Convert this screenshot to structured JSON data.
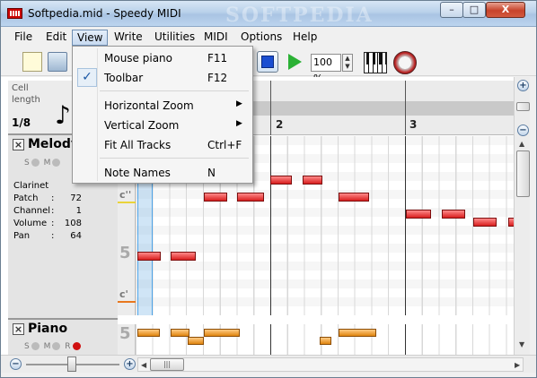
{
  "window": {
    "title": "Softpedia.mid - Speedy MIDI",
    "watermark": "SOFTPEDIA",
    "minimize": "–",
    "maximize": "□",
    "close": "X"
  },
  "menubar": {
    "items": [
      "File",
      "Edit",
      "View",
      "Write",
      "Utilities",
      "MIDI",
      "Options",
      "Help"
    ],
    "active": "View"
  },
  "toolbar": {
    "zoom_value": "100 %",
    "icons": [
      "new-document-icon",
      "open-folder-icon",
      "stop-icon",
      "play-icon",
      "piano-icon",
      "drum-icon"
    ]
  },
  "view_menu": {
    "items": [
      {
        "label": "Mouse piano",
        "shortcut": "F11",
        "checked": false,
        "submenu": false
      },
      {
        "label": "Toolbar",
        "shortcut": "F12",
        "checked": true,
        "submenu": false
      },
      {
        "label": "Horizontal Zoom",
        "shortcut": "",
        "checked": false,
        "submenu": true
      },
      {
        "label": "Vertical Zoom",
        "shortcut": "",
        "checked": false,
        "submenu": true
      },
      {
        "label": "Fit All Tracks",
        "shortcut": "Ctrl+F",
        "checked": false,
        "submenu": false
      },
      {
        "label": "Note Names",
        "shortcut": "N",
        "checked": false,
        "submenu": false
      }
    ]
  },
  "cell": {
    "label": "Cell length",
    "value": "1/8",
    "icon": "eighth-note-icon"
  },
  "ruler": {
    "measures": [
      "2",
      "3"
    ]
  },
  "tracks": [
    {
      "name": "Melody",
      "solo": "S",
      "mute": "M",
      "instrument": "Clarinet",
      "props": [
        {
          "key": "Patch",
          "value": "72"
        },
        {
          "key": "Channel",
          "value": "1"
        },
        {
          "key": "Volume",
          "value": "108"
        },
        {
          "key": "Pan",
          "value": "64"
        }
      ],
      "lane_labels": [
        "c''",
        "5",
        "c'"
      ]
    },
    {
      "name": "Piano",
      "solo": "S",
      "mute": "M",
      "record": "R",
      "lane_labels": [
        "5"
      ]
    }
  ],
  "colors": {
    "melody_note": "#d81e1e",
    "piano_note": "#e0850f",
    "playhead": "#4ea3e6"
  }
}
